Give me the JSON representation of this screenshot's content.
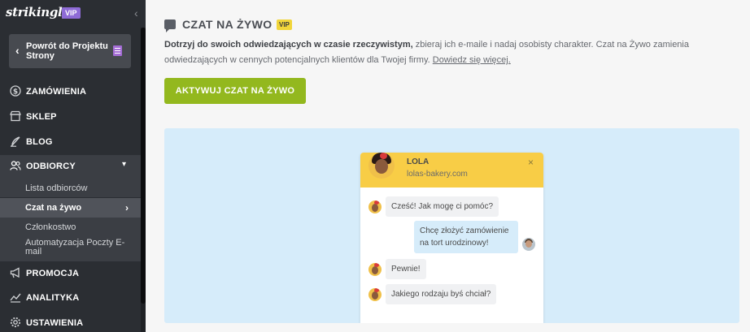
{
  "sidebar": {
    "logo": "strikingly",
    "vip": "VIP",
    "back_button": "Powrót do Projektu Strony",
    "nav": [
      {
        "label": "ZAMÓWIENIA",
        "icon": "dollar-circle-icon"
      },
      {
        "label": "SKLEP",
        "icon": "store-icon"
      },
      {
        "label": "BLOG",
        "icon": "quill-icon"
      },
      {
        "label": "ODBIORCY",
        "icon": "people-icon"
      },
      {
        "label": "PROMOCJA",
        "icon": "megaphone-icon"
      },
      {
        "label": "ANALITYKA",
        "icon": "chart-icon"
      },
      {
        "label": "USTAWIENIA",
        "icon": "gear-icon"
      }
    ],
    "subnav": [
      {
        "label": "Lista odbiorców"
      },
      {
        "label": "Czat na żywo"
      },
      {
        "label": "Członkostwo"
      },
      {
        "label": "Automatyzacja Poczty E-mail"
      }
    ]
  },
  "main": {
    "title": "CZAT NA ŻYWO",
    "vip": "VIP",
    "desc_bold": "Dotrzyj do swoich odwiedzających w czasie rzeczywistym,",
    "desc_rest": " zbieraj ich e-maile i nadaj osobisty charakter. Czat na Żywo zamienia odwiedzających w cennych potencjalnych klientów dla Twojej firmy. ",
    "desc_link": "Dowiedz się więcej.",
    "cta": "AKTYWUJ CZAT NA ŻYWO"
  },
  "widget": {
    "name": "LOLA",
    "url": "lolas-bakery.com",
    "close": "×",
    "messages": [
      {
        "from": "agent",
        "text": "Cześć! Jak mogę ci pomóc?"
      },
      {
        "from": "user",
        "text": "Chcę złożyć zamówienie na tort urodzinowy!"
      },
      {
        "from": "agent",
        "text": "Pewnie!"
      },
      {
        "from": "agent",
        "text": "Jakiego rodzaju byś chciał?"
      }
    ]
  },
  "colors": {
    "sidebar_bg": "#2b2e33",
    "cta_green": "#93b81e",
    "widget_header": "#f8cd46",
    "preview_bg": "#d6ecfa",
    "vip_purple": "#8e6bd6",
    "vip_yellow": "#f1d53a"
  }
}
